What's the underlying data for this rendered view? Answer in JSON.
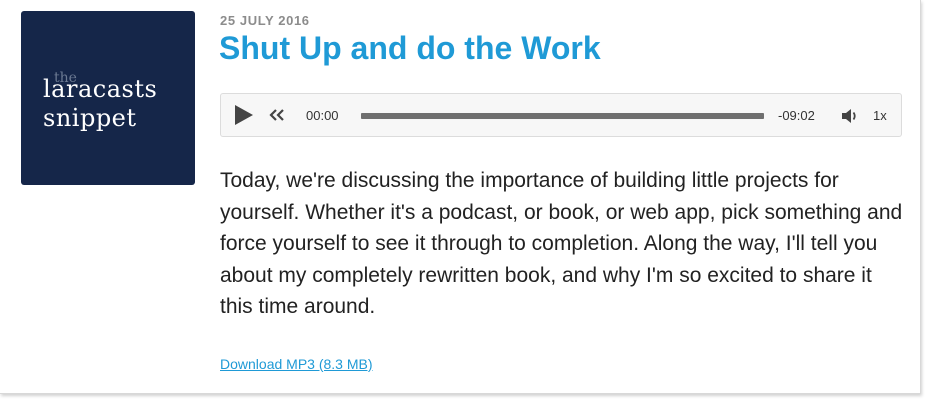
{
  "podcast": {
    "cover": {
      "small_text": "the",
      "line1": "laracasts",
      "line2": "snippet",
      "background": "#152649"
    }
  },
  "episode": {
    "date": "25 JULY 2016",
    "title": "Shut Up and do the Work",
    "description": "Today, we're discussing the importance of building little projects for yourself. Whether it's a podcast, or book, or web app, pick something and force yourself to see it through to completion. Along the way, I'll tell you about my completely rewritten book, and why I'm so excited to share it this time around.",
    "download_label": "Download MP3 (8.3 MB)"
  },
  "player": {
    "current_time": "00:00",
    "remaining_time": "-09:02",
    "speed": "1x",
    "progress_fraction": 1.0,
    "icons": {
      "play": "play-icon",
      "rewind": "rewind-icon",
      "volume": "volume-icon"
    }
  },
  "colors": {
    "accent": "#1f9ad6",
    "date": "#8c8c8c",
    "text": "#222222"
  }
}
